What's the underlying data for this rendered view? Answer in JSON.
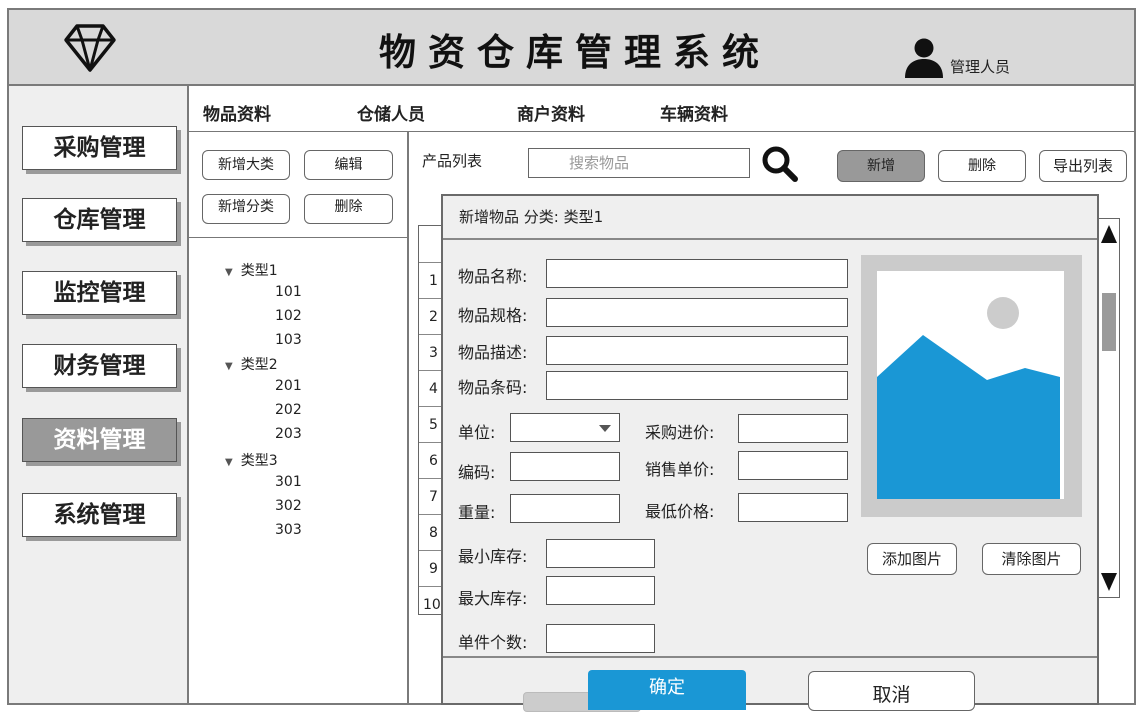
{
  "header": {
    "title": "物资仓库管理系统",
    "user_label": "管理人员"
  },
  "sidebar": {
    "items": [
      {
        "label": "采购管理",
        "active": false
      },
      {
        "label": "仓库管理",
        "active": false
      },
      {
        "label": "监控管理",
        "active": false
      },
      {
        "label": "财务管理",
        "active": false
      },
      {
        "label": "资料管理",
        "active": true
      },
      {
        "label": "系统管理",
        "active": false
      }
    ]
  },
  "topnav": {
    "tabs": [
      "物品资料",
      "仓储人员",
      "商户资料",
      "车辆资料"
    ]
  },
  "tree_panel": {
    "add_category": "新增大类",
    "edit": "编辑",
    "add_subcategory": "新增分类",
    "delete": "删除",
    "tree": [
      {
        "label": "类型1",
        "children": [
          "101",
          "102",
          "103"
        ]
      },
      {
        "label": "类型2",
        "children": [
          "201",
          "202",
          "203"
        ]
      },
      {
        "label": "类型3",
        "children": [
          "301",
          "302",
          "303"
        ]
      }
    ]
  },
  "content": {
    "list_label": "产品列表",
    "search_placeholder": "搜索物品",
    "add": "新增",
    "delete": "删除",
    "export": "导出列表",
    "rows": [
      "1",
      "2",
      "3",
      "4",
      "5",
      "6",
      "7",
      "8",
      "9",
      "10"
    ]
  },
  "modal": {
    "title": "新增物品  分类: 类型1",
    "fields": {
      "name": "物品名称:",
      "spec": "物品规格:",
      "desc": "物品描述:",
      "barcode": "物品条码:",
      "unit": "单位:",
      "code": "编码:",
      "weight": "重量:",
      "purchase_price": "采购进价:",
      "sale_price": "销售单价:",
      "min_price": "最低价格:",
      "min_stock": "最小库存:",
      "max_stock": "最大库存:",
      "unit_count": "单件个数:"
    },
    "add_image": "添加图片",
    "clear_image": "清除图片",
    "confirm": "确定",
    "cancel": "取消"
  },
  "colors": {
    "accent": "#1a97d5",
    "header_bg": "#d9d9d9",
    "sidebar_bg": "#efefef",
    "active_gray": "#999999"
  }
}
